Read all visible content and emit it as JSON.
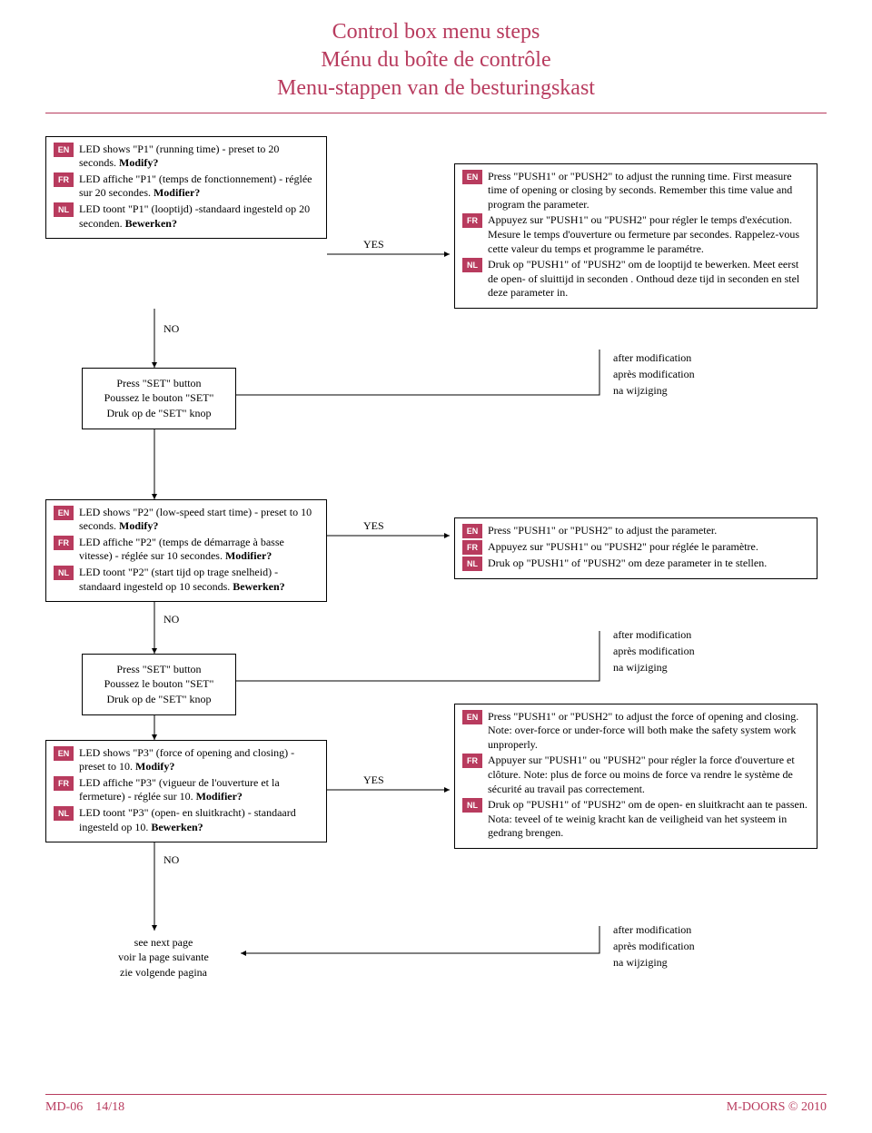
{
  "title": {
    "en": "Control box menu steps",
    "fr": "Ménu du boîte de contrôle",
    "nl": "Menu-stappen van de besturingskast"
  },
  "lang": {
    "en": "EN",
    "fr": "FR",
    "nl": "NL"
  },
  "labels": {
    "yes": "YES",
    "no": "NO"
  },
  "set_button": {
    "en": "Press \"SET\" button",
    "fr": "Poussez le bouton \"SET\"",
    "nl": "Druk op de \"SET\" knop"
  },
  "p1_q": {
    "en_a": "LED shows \"P1\" (running time) - preset to 20 seconds. ",
    "en_b": "Modify?",
    "fr_a": "LED affiche \"P1\" (temps de fonctionnement) - réglée sur 20 secondes. ",
    "fr_b": "Modifier?",
    "nl_a": "LED toont \"P1\" (looptijd) -standaard ingesteld op 20 seconden. ",
    "nl_b": "Bewerken?"
  },
  "p1_a": {
    "en": "Press \"PUSH1\" or \"PUSH2\" to adjust the running time. First measure time of opening or closing by seconds. Remember this time value and program the parameter.",
    "fr": "Appuyez sur \"PUSH1\" ou \"PUSH2\" pour régler le temps d'exécution. Mesure le temps d'ouverture ou fermeture par secondes. Rappelez-vous cette valeur du temps et programme le paramétre.",
    "nl": "Druk op \"PUSH1\" of \"PUSH2\" om de looptijd te bewerken. Meet eerst de open- of sluittijd in seconden . Onthoud deze tijd in seconden en stel deze parameter in."
  },
  "p2_q": {
    "en_a": "LED shows \"P2\" (low-speed start time) - preset to 10 seconds. ",
    "en_b": "Modify?",
    "fr_a": "LED affiche \"P2\" (temps de démarrage à basse vitesse) - réglée sur 10 secondes. ",
    "fr_b": "Modifier?",
    "nl_a": "LED toont \"P2\" (start tijd op trage snelheid) - standaard ingesteld op 10 seconds. ",
    "nl_b": "Bewerken?"
  },
  "p2_a": {
    "en": "Press \"PUSH1\" or \"PUSH2\" to adjust the parameter.",
    "fr": "Appuyez sur \"PUSH1\" ou \"PUSH2\" pour réglée le paramètre.",
    "nl": "Druk op \"PUSH1\" of \"PUSH2\" om deze parameter in te stellen."
  },
  "p3_q": {
    "en_a": "LED shows \"P3\" (force of opening and closing) - preset to 10. ",
    "en_b": "Modify?",
    "fr_a": "LED affiche \"P3\" (vigueur de l'ouverture et la fermeture) - réglée sur 10. ",
    "fr_b": "Modifier?",
    "nl_a": "LED toont \"P3\" (open- en sluitkracht) - standaard ingesteld op 10. ",
    "nl_b": "Bewerken?"
  },
  "p3_a": {
    "en": "Press \"PUSH1\" or \"PUSH2\" to adjust the force of opening and closing. Note: over-force or under-force will both make the safety system work unproperly.",
    "fr": "Appuyer sur \"PUSH1\" ou \"PUSH2\" pour régler la force d'ouverture et clôture. Note: plus de force ou moins de force  va rendre le système de sécurité au travail pas correctement.",
    "nl": "Druk op \"PUSH1\" of \"PUSH2\" om de open- en sluitkracht aan te passen. Nota: teveel of te weinig kracht kan de veiligheid van het systeem in gedrang brengen."
  },
  "after_mod": {
    "en": "after modification",
    "fr": "après modification",
    "nl": "na wijziging"
  },
  "next_page": {
    "en": "see next page",
    "fr": "voir la page suivante",
    "nl": "zie volgende pagina"
  },
  "footer": {
    "left": "MD-06    14/18",
    "right": "M-DOORS © 2010"
  }
}
